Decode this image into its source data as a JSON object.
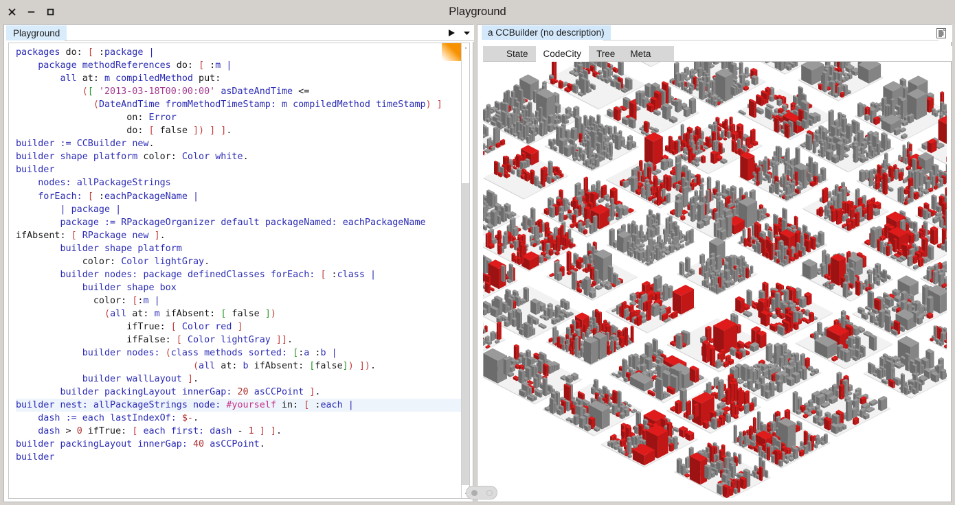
{
  "window": {
    "title": "Playground",
    "controls": [
      {
        "name": "close",
        "glyph": "✕"
      },
      {
        "name": "minimize",
        "glyph": "−"
      },
      {
        "name": "maximize",
        "glyph": "□"
      }
    ]
  },
  "left_pane": {
    "tab_label": "Playground",
    "play_button_label": "▶",
    "menu_button_label": "▼",
    "code_lines": [
      "packages do: [ :package |",
      "    package methodReferences do: [ :m |",
      "        all at: m compiledMethod put:",
      "            ([ '2013-03-18T00:00:00' asDateAndTime <=",
      "              (DateAndTime fromMethodTimeStamp: m compiledMethod timeStamp) ]",
      "                    on: Error",
      "                    do: [ false ]) ] ].",
      "builder := CCBuilder new.",
      "builder shape platform color: Color white.",
      "builder",
      "    nodes: allPackageStrings",
      "    forEach: [ :eachPackageName |",
      "        | package |",
      "        package := RPackageOrganizer default packageNamed: eachPackageName",
      "ifAbsent: [ RPackage new ].",
      "        builder shape platform",
      "            color: Color lightGray.",
      "        builder nodes: package definedClasses forEach: [ :class |",
      "            builder shape box",
      "              color: [:m |",
      "                (all at: m ifAbsent: [ false ])",
      "                    ifTrue: [ Color red ]",
      "                    ifFalse: [ Color lightGray ]].",
      "            builder nodes: (class methods sorted: [:a :b |",
      "                                (all at: b ifAbsent: [false]) ]).",
      "            builder wallLayout ].",
      "        builder packingLayout innerGap: 20 asCCPoint ].",
      "builder nest: allPackageStrings node: #yourself in: [ :each |",
      "    dash := each lastIndexOf: $-.",
      "    dash > 0 ifTrue: [ each first: dash - 1 ] ].",
      "builder packingLayout innerGap: 40 asCCPoint.",
      "builder"
    ],
    "highlighted_line_index": 27,
    "toggle": {
      "left_state": "on",
      "right_state": "off"
    }
  },
  "right_pane": {
    "tab_label": "a CCBuilder (no description)",
    "doc_icon": "document-icon",
    "subtabs": [
      {
        "label": "State",
        "active": false
      },
      {
        "label": "CodeCity",
        "active": true
      },
      {
        "label": "Tree",
        "active": false
      },
      {
        "label": "Meta",
        "active": false
      }
    ],
    "visualization": {
      "name": "codecity-visualization",
      "kind": "isometric-3d-city",
      "platform_color": "#f2f2f2",
      "box_colors": {
        "highlight": "#e01b1b",
        "normal": "#9a9a9a"
      },
      "background": "#ffffff"
    }
  },
  "colors": {
    "titlebar": "#d4d0cc",
    "tab_active": "#d9ecfb",
    "editor_corner_accent": "#f79100",
    "subtab_inactive": "#d7d7d7"
  }
}
